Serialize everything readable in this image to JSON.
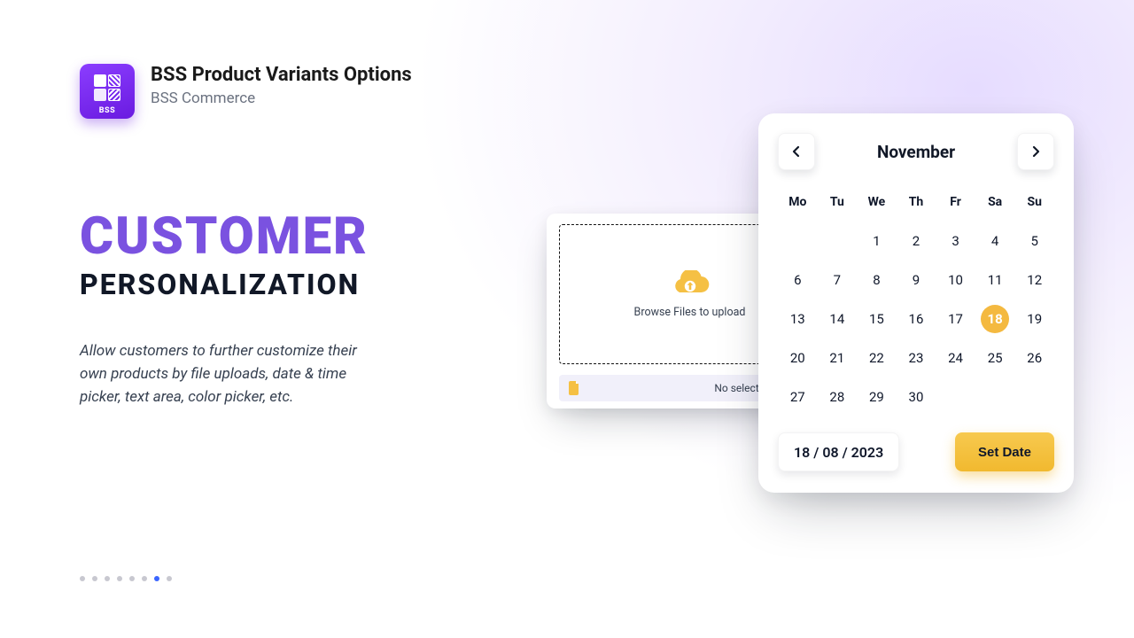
{
  "header": {
    "app_title": "BSS Product Variants Options",
    "company": "BSS Commerce",
    "logo_text": "BSS"
  },
  "hero": {
    "title": "CUSTOMER",
    "subtitle": "PERSONALIZATION",
    "description": "Allow customers to further customize their own products by file uploads, date & time picker, text area, color picker, etc."
  },
  "carousel": {
    "count": 8,
    "active_index": 6
  },
  "upload": {
    "prompt": "Browse Files to upload",
    "status": "No selected File -"
  },
  "calendar": {
    "month_label": "November",
    "weekdays": [
      "Mo",
      "Tu",
      "We",
      "Th",
      "Fr",
      "Sa",
      "Su"
    ],
    "leading_blanks": 2,
    "days_in_month": 30,
    "selected_day": 18,
    "date_display": "18 / 08 / 2023",
    "set_button": "Set Date"
  },
  "colors": {
    "accent_purple": "#7a52e0",
    "accent_amber": "#f4b940"
  }
}
